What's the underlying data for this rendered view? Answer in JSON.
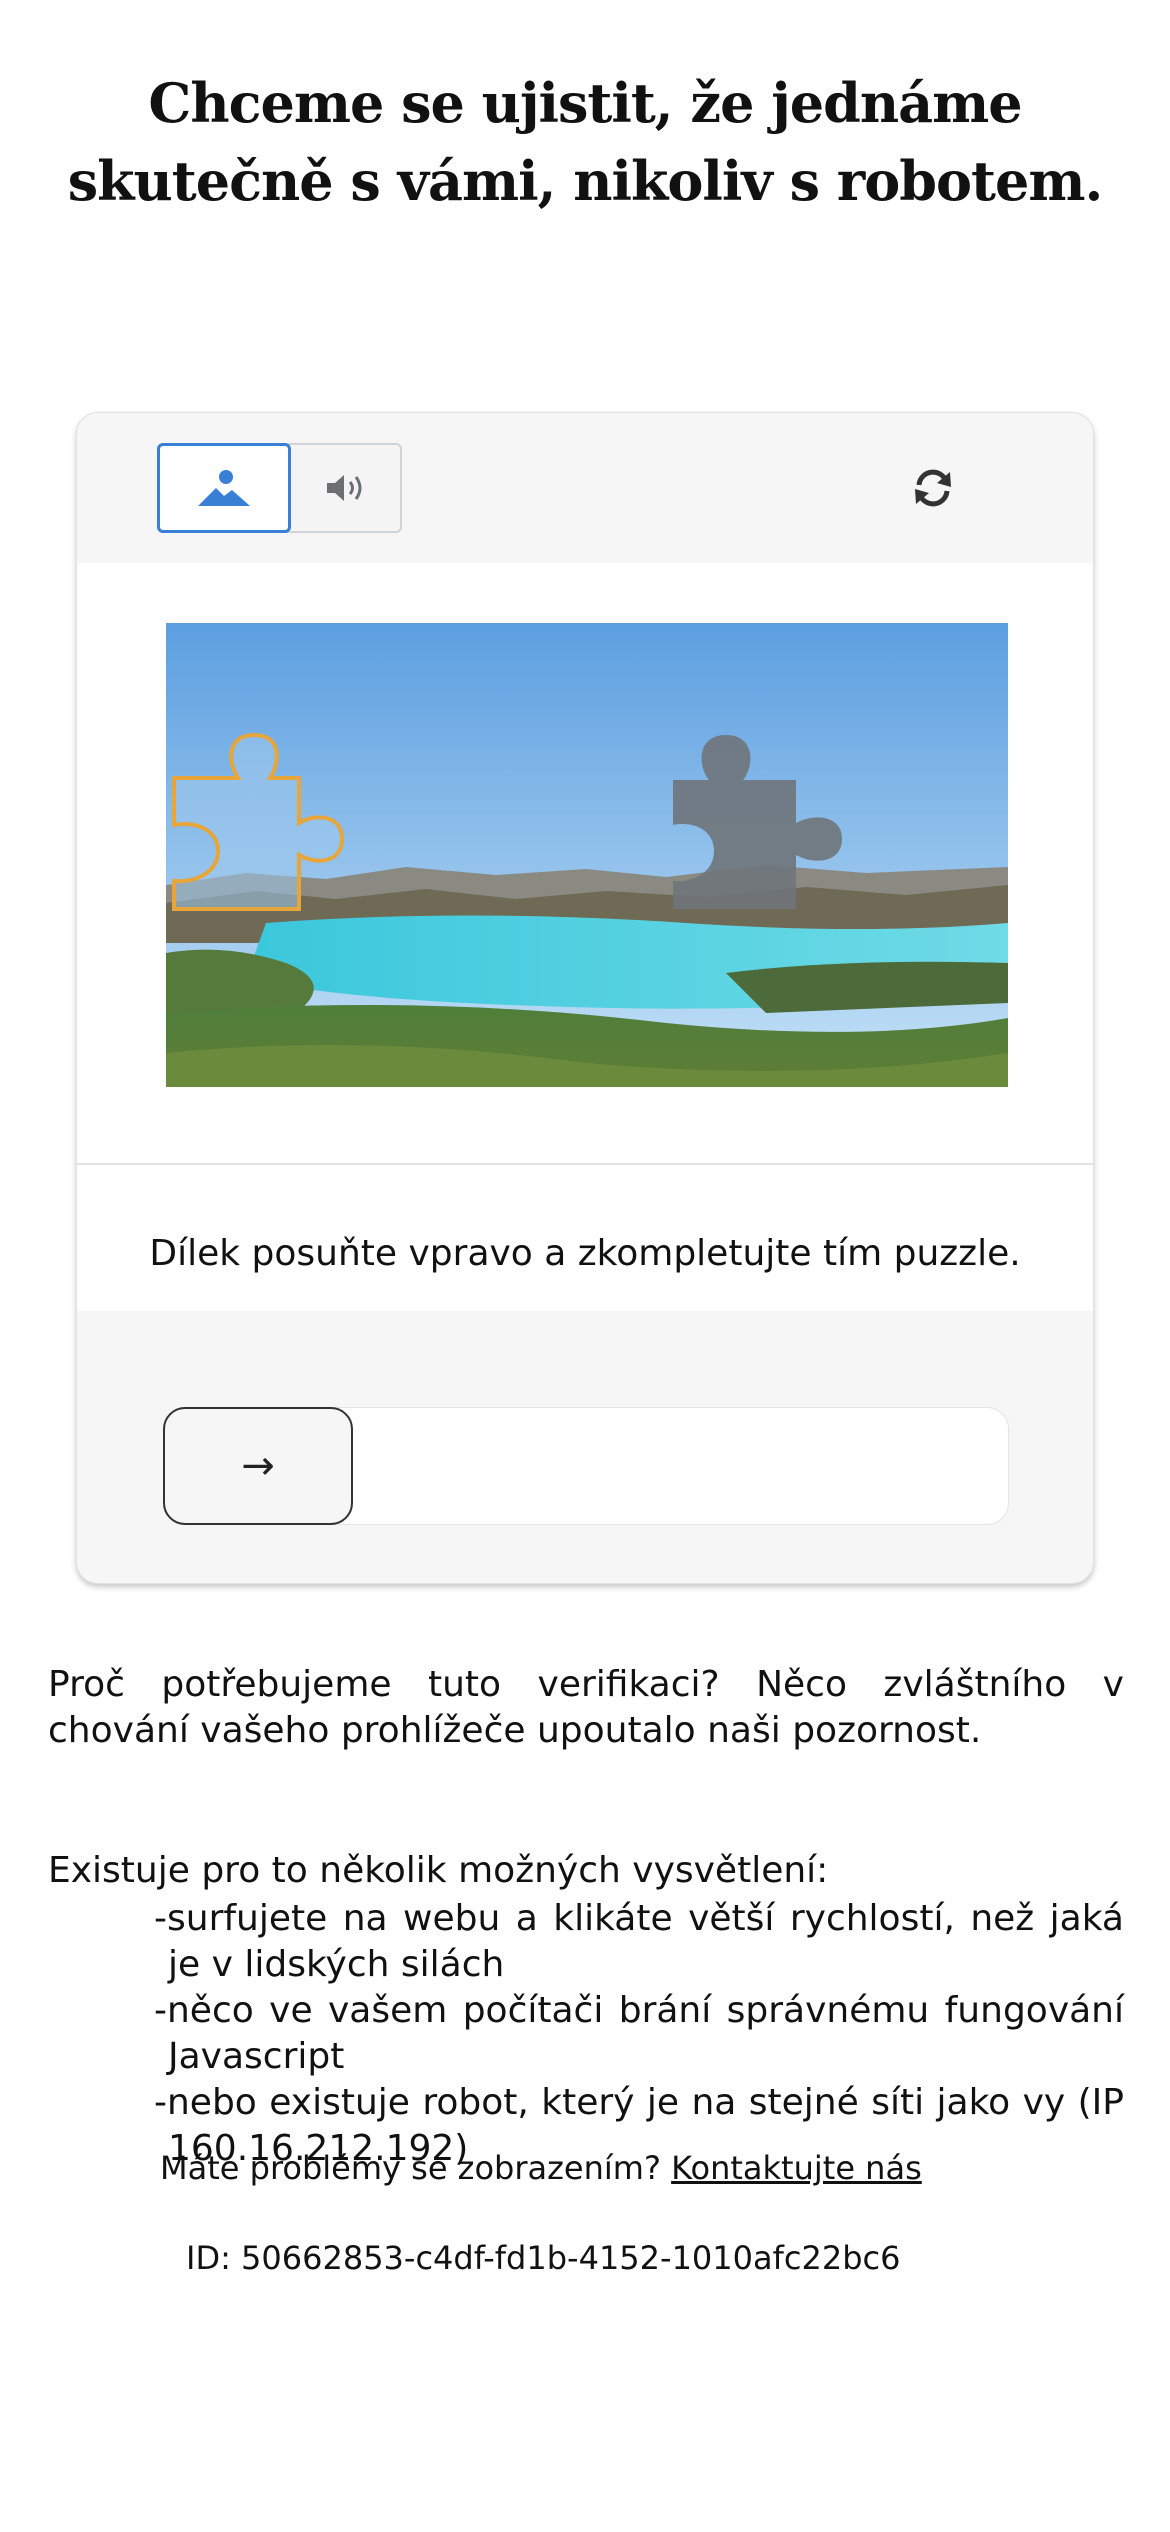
{
  "heading": "Chceme se ujistit, že jednáme skutečně s vámi, nikoliv s robotem.",
  "captcha": {
    "modes": [
      {
        "icon": "image-icon",
        "selected": true
      },
      {
        "icon": "speaker-icon",
        "selected": false
      }
    ],
    "refresh_icon": "refresh-icon",
    "instruction": "Dílek posuňte vpravo a zkompletujte tím puzzle.",
    "slider_arrow": "→",
    "colors": {
      "selected": "#3a7fd6",
      "piece_outline": "#e8a53a",
      "piece_slot": "#6f747a"
    }
  },
  "info": {
    "why": "Proč potřebujeme tuto verifikaci? Něco zvláštního v chování vašeho prohlížeče upoutalo naši pozornost.",
    "explanations_intro": "Existuje pro to několik možných vysvětlení:",
    "explanations": [
      "-surfujete na webu a klikáte větší rychlostí, než jaká je v lidských silách",
      "-něco ve vašem počítači brání správnému fungování Javascript",
      "-nebo existuje robot, který je na stejné síti jako vy (IP 160.16.212.192)"
    ]
  },
  "help": {
    "text": "Máte problémy se zobrazením?",
    "link": "Kontaktujte nás"
  },
  "id_text": "ID: 50662853-c4df-fd1b-4152-1010afc22bc6"
}
